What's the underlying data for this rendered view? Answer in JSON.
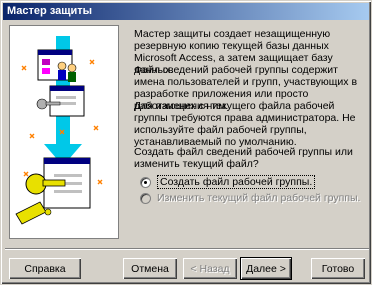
{
  "window": {
    "title": "Мастер защиты"
  },
  "intro": {
    "p1": "Мастер защиты создает незащищенную резервную копию текущей базы данных Microsoft Access, а затем защищает базу данных.",
    "p2": "Файл сведений рабочей группы содержит имена пользователей и групп, участвующих в разработке приложения или просто работающих с ним.",
    "p3": "Для изменения текущего файла рабочей группы требуются права администратора. Не используйте файл рабочей группы, устанавливаемый по умолчанию."
  },
  "question": "Создать файл сведений рабочей группы или изменить текущий файл?",
  "options": [
    {
      "label": "Создать файл рабочей группы.",
      "selected": true,
      "enabled": true
    },
    {
      "label": "Изменить текущий файл рабочей группы.",
      "selected": false,
      "enabled": false
    }
  ],
  "buttons": {
    "help": "Справка",
    "cancel": "Отмена",
    "back": "< Назад",
    "next": "Далее >",
    "finish": "Готово"
  },
  "colors": {
    "title_start": "#0a246a",
    "title_end": "#a6caf0",
    "face": "#d4d0c8",
    "arrow": "#00c0e0",
    "key": "#e8e000"
  }
}
